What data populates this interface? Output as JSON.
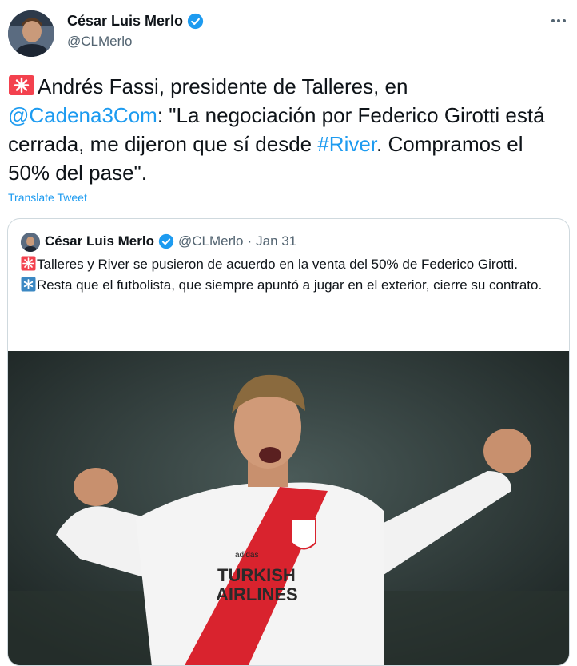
{
  "author": {
    "name": "César Luis Merlo",
    "handle": "@CLMerlo",
    "avatar_icon": "profile-avatar",
    "verified_icon": "verified-badge-icon"
  },
  "tweet": {
    "text_part1": "Andrés Fassi, presidente de Talleres, en ",
    "mention": "@Cadena3Com",
    "text_part2": ": \"La negociación por Federico Girotti está cerrada, me dijeron que sí desde ",
    "hashtag": "#River",
    "text_part3": ". Compramos el 50% del pase\".",
    "translate_label": "Translate Tweet"
  },
  "quoted": {
    "name": "César Luis Merlo",
    "handle": "@CLMerlo",
    "separator": "·",
    "date": "Jan 31",
    "line1": "Talleres y River se pusieron de acuerdo en la venta del 50% de Federico Girotti.",
    "line2": "Resta que el futbolista, que siempre apuntó a jugar en el exterior, cierre su contrato.",
    "image": {
      "sponsor_line1": "TURKISH",
      "sponsor_line2": "AIRLINES",
      "brand": "adidas"
    }
  },
  "colors": {
    "link": "#1d9bf0",
    "secondary_text": "#536471",
    "border": "#cfd9de",
    "siren": "#f3414e"
  }
}
